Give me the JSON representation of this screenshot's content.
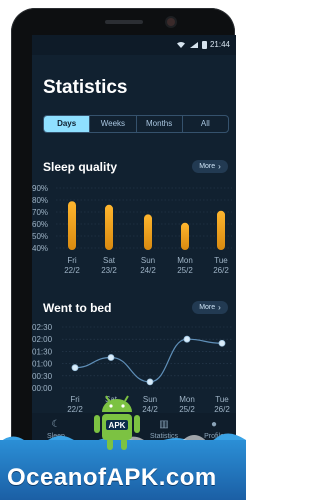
{
  "status_bar": {
    "time": "21:44"
  },
  "title": "Statistics",
  "tabs": [
    {
      "label": "Days",
      "active": true
    },
    {
      "label": "Weeks",
      "active": false
    },
    {
      "label": "Months",
      "active": false
    },
    {
      "label": "All",
      "active": false
    }
  ],
  "sleep_quality": {
    "title": "Sleep quality",
    "more_label": "More"
  },
  "went_to_bed": {
    "title": "Went to bed",
    "more_label": "More"
  },
  "chart_data": [
    {
      "type": "bar",
      "title": "Sleep quality",
      "categories": [
        "Fri",
        "Sat",
        "Sun",
        "Mon",
        "Tue"
      ],
      "dates": [
        "22/2",
        "23/2",
        "24/2",
        "25/2",
        "26/2"
      ],
      "values": [
        79,
        76,
        68,
        61,
        71
      ],
      "y_ticks": [
        "90%",
        "80%",
        "70%",
        "60%",
        "50%",
        "40%"
      ],
      "ylim": [
        40,
        90
      ],
      "color": "#f6a623"
    },
    {
      "type": "line",
      "title": "Went to bed",
      "categories": [
        "Fri",
        "Sat",
        "Sun",
        "Mon",
        "Tue"
      ],
      "dates": [
        "22/2",
        "23/2",
        "24/2",
        "25/2",
        "26/2"
      ],
      "values": [
        "00:50",
        "01:15",
        "00:15",
        "02:00",
        "01:50"
      ],
      "y_ticks": [
        "02:30",
        "02:00",
        "01:30",
        "01:00",
        "00:30",
        "00:00"
      ],
      "ylim": [
        "00:00",
        "02:30"
      ],
      "color": "#5f8fb8"
    }
  ],
  "bottom_nav": {
    "items": [
      {
        "label": "Sleep",
        "icon": "moon-icon"
      },
      {
        "label": "Statistics",
        "icon": "chart-icon"
      },
      {
        "label": "Profile",
        "icon": "person-icon"
      }
    ]
  },
  "watermark": {
    "text": "OceanofAPK.com",
    "badge": "APK"
  }
}
